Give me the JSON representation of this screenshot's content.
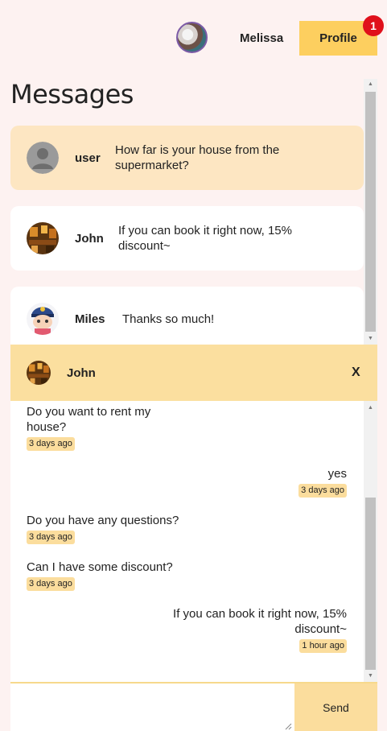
{
  "header": {
    "user_name": "Melissa",
    "profile_label": "Profile",
    "notification_count": "1"
  },
  "page_title": "Messages",
  "conversations": [
    {
      "name": "user",
      "preview": "How far is your house from the supermarket?",
      "active": true
    },
    {
      "name": "John",
      "preview": "If you can book it right now, 15% discount~",
      "active": false
    },
    {
      "name": "Miles",
      "preview": "Thanks so much!",
      "active": false
    }
  ],
  "chat": {
    "name": "John",
    "close_label": "X",
    "messages": [
      {
        "side": "left",
        "text": "Do you want to rent my house?",
        "time": "3 days ago"
      },
      {
        "side": "right",
        "text": "yes",
        "time": "3 days ago"
      },
      {
        "side": "left",
        "text": "Do you have any questions?",
        "time": "3 days ago"
      },
      {
        "side": "left",
        "text": "Can I have some discount?",
        "time": "3 days ago"
      },
      {
        "side": "right",
        "text": "If you can book it right now, 15% discount~",
        "time": "1 hour ago"
      }
    ],
    "input_placeholder": "",
    "send_label": "Send"
  },
  "colors": {
    "background": "#fdf2f1",
    "accent": "#fdcf5f",
    "active_card": "#fde6c2",
    "chat_header": "#fbdf9f",
    "badge": "#e0101b"
  }
}
